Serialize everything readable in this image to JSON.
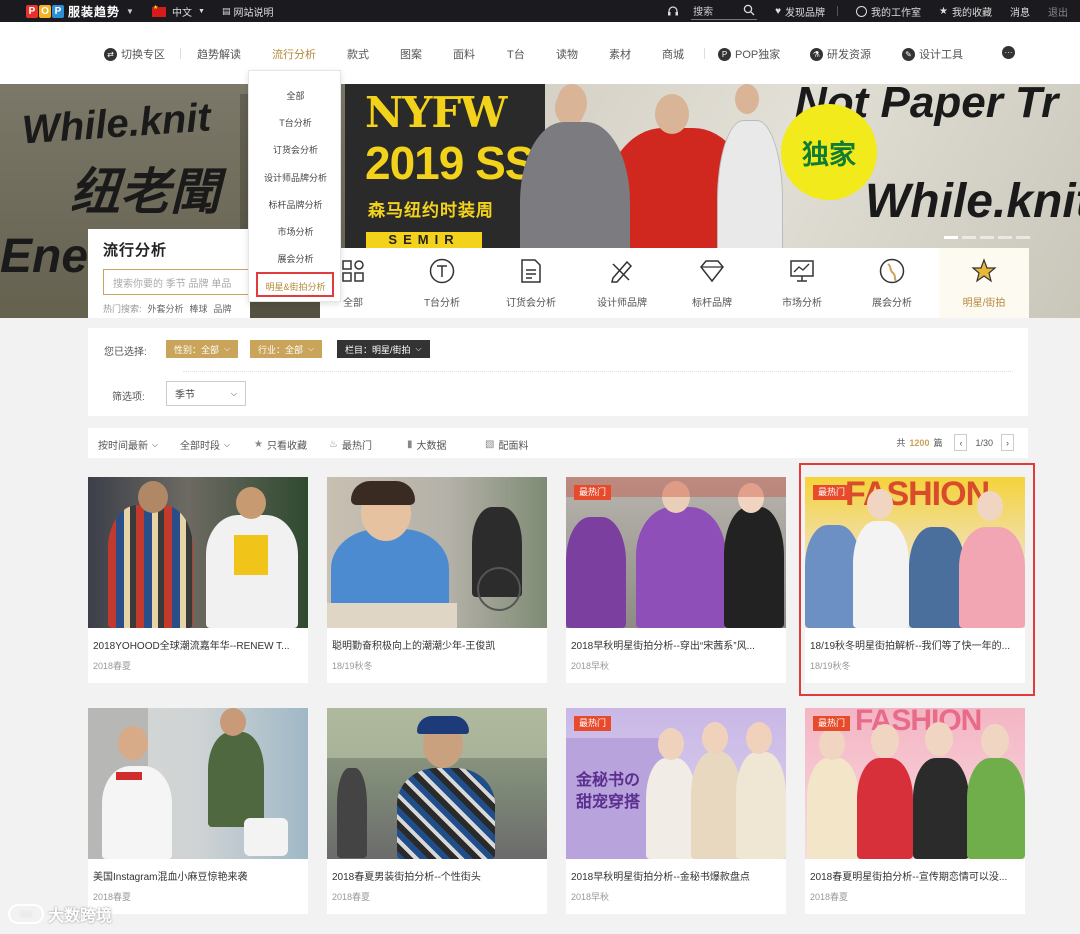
{
  "topbar": {
    "logo_letters": [
      "P",
      "O",
      "P"
    ],
    "logo_text": "服装趋势",
    "language": "中文",
    "site_guide": "网站说明",
    "search_label": "搜索",
    "discover_brand": "发现品牌",
    "my_studio": "我的工作室",
    "my_favorites": "我的收藏",
    "messages": "消息",
    "logout": "退出"
  },
  "nav": {
    "items": [
      "切换专区",
      "趋势解读",
      "流行分析",
      "款式",
      "图案",
      "面料",
      "T台",
      "读物",
      "素材",
      "商城",
      "POP独家",
      "研发资源",
      "设计工具"
    ],
    "active_index": 2
  },
  "dropdown": {
    "items": [
      "全部",
      "T台分析",
      "订货会分析",
      "设计师品牌分析",
      "标杆品牌分析",
      "市场分析",
      "展会分析",
      "明星&街拍分析"
    ],
    "highlighted_index": 7
  },
  "banner": {
    "left_text_1": "While.knit",
    "left_text_2": "纽老聞",
    "left_text_3": "Ene",
    "nyfw": "NYFW",
    "season": "2019 SS",
    "subtitle": "森马纽约时装周",
    "brand": "SEMIR",
    "exclusive": "独家",
    "right_text_1": "Not Paper Tr",
    "right_text_2": "While.knit"
  },
  "analysis": {
    "title": "流行分析",
    "search_placeholder": "搜索你要的 季节 品牌 单品",
    "hot_label": "热门搜索:",
    "hot_terms": [
      "外套分析",
      "棒球",
      "品牌"
    ]
  },
  "categories": {
    "items": [
      "全部",
      "T台分析",
      "订货会分析",
      "设计师品牌",
      "标杆品牌",
      "市场分析",
      "展会分析",
      "明星/街拍"
    ],
    "active_index": 7
  },
  "filters": {
    "selected_label": "您已选择:",
    "chips": [
      "性别：全部",
      "行业：全部",
      "栏目：明星/街拍"
    ],
    "filter_label": "筛选项:",
    "season_select": "季节"
  },
  "sort": {
    "by_time": "按时间最新",
    "all_periods": "全部时段",
    "favorites_only": "只看收藏",
    "hottest": "最热门",
    "big_data": "大数据",
    "with_fabric": "配面料",
    "total_prefix": "共",
    "total_count": "1200",
    "total_suffix": "篇",
    "page_info": "1/30"
  },
  "cards": [
    {
      "title": "2018YOHOOD全球潮流嘉年华--RENEW T...",
      "season": "2018春夏",
      "hot": false,
      "hot_label": ""
    },
    {
      "title": "聪明勤奋积极向上的潮潮少年-王俊凯",
      "season": "18/19秋冬",
      "hot": false,
      "hot_label": ""
    },
    {
      "title": "2018早秋明星街拍分析--穿出“宋茜系”风...",
      "season": "2018早秋",
      "hot": true,
      "hot_label": "最热门"
    },
    {
      "title": "18/19秋冬明星街拍解析--我们等了快一年的...",
      "season": "18/19秋冬",
      "hot": true,
      "hot_label": "最热门"
    },
    {
      "title": "美国Instagram混血小麻豆惊艳来袭",
      "season": "2018春夏",
      "hot": false,
      "hot_label": ""
    },
    {
      "title": "2018春夏男装街拍分析--个性街头",
      "season": "2018春夏",
      "hot": false,
      "hot_label": ""
    },
    {
      "title": "2018早秋明星街拍分析--金秘书爆款盘点",
      "season": "2018早秋",
      "hot": true,
      "hot_label": "最热门"
    },
    {
      "title": "2018春夏明星街拍分析--宣传期恋情可以没...",
      "season": "2018春夏",
      "hot": true,
      "hot_label": "最热门"
    }
  ],
  "card_image_text": {
    "card7_line1": "金秘书の",
    "card7_line2": "甜宠穿搭",
    "card4_fashion": "FASHION",
    "card8_fashion": "FASHION"
  },
  "watermark": "大数跨境",
  "colors": {
    "accent_gold": "#c9a45a",
    "highlight_red": "#e13b3b",
    "hot_badge": "#e84a2c",
    "topbar": "#1b1b1f"
  }
}
